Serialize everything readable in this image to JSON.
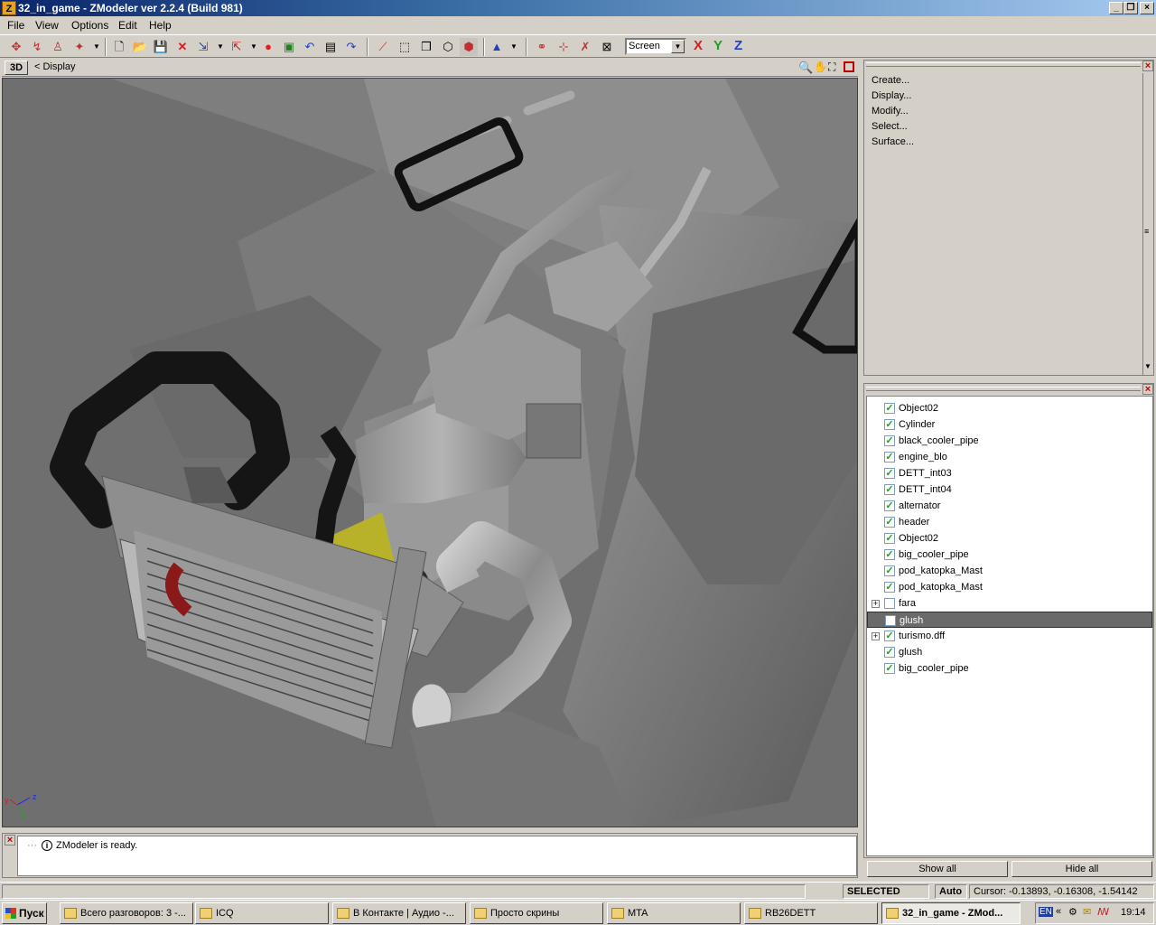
{
  "window": {
    "app_icon": "Z",
    "title": "32_in_game - ZModeler ver 2.2.4 (Build 981)"
  },
  "menu": [
    "File",
    "View",
    "Options",
    "Edit",
    "Help"
  ],
  "toolbar": {
    "view_mode": "Screen",
    "axes": [
      "X",
      "Y",
      "Z"
    ]
  },
  "viewport": {
    "mode_button": "3D",
    "breadcrumb": "< Display",
    "axis_labels": [
      "y",
      "z",
      "x"
    ]
  },
  "command_panel": {
    "commands": [
      "Create...",
      "Display...",
      "Modify...",
      "Select...",
      "Surface..."
    ]
  },
  "object_panel": {
    "objects": [
      {
        "name": "Object02",
        "checked": true,
        "expandable": false,
        "selected": false
      },
      {
        "name": "Cylinder",
        "checked": true,
        "expandable": false,
        "selected": false
      },
      {
        "name": "black_cooler_pipe",
        "checked": true,
        "expandable": false,
        "selected": false
      },
      {
        "name": "engine_blo",
        "checked": true,
        "expandable": false,
        "selected": false
      },
      {
        "name": "DETT_int03",
        "checked": true,
        "expandable": false,
        "selected": false
      },
      {
        "name": "DETT_int04",
        "checked": true,
        "expandable": false,
        "selected": false
      },
      {
        "name": "alternator",
        "checked": true,
        "expandable": false,
        "selected": false
      },
      {
        "name": "header",
        "checked": true,
        "expandable": false,
        "selected": false
      },
      {
        "name": "Object02",
        "checked": true,
        "expandable": false,
        "selected": false
      },
      {
        "name": "big_cooler_pipe",
        "checked": true,
        "expandable": false,
        "selected": false
      },
      {
        "name": "pod_katopka_Mast",
        "checked": true,
        "expandable": false,
        "selected": false
      },
      {
        "name": "pod_katopka_Mast",
        "checked": true,
        "expandable": false,
        "selected": false
      },
      {
        "name": "fara",
        "checked": false,
        "expandable": true,
        "selected": false
      },
      {
        "name": "glush",
        "checked": false,
        "expandable": false,
        "selected": true
      },
      {
        "name": "turismo.dff",
        "checked": true,
        "expandable": true,
        "selected": false
      },
      {
        "name": "glush",
        "checked": true,
        "expandable": false,
        "selected": false
      },
      {
        "name": "big_cooler_pipe",
        "checked": true,
        "expandable": false,
        "selected": false
      }
    ],
    "show_all": "Show all",
    "hide_all": "Hide all"
  },
  "log": {
    "message": "ZModeler is ready."
  },
  "status": {
    "mode": "SELECTED MODE",
    "auto": "Auto",
    "cursor": "Cursor: -0.13893, -0.16308, -1.54142"
  },
  "taskbar": {
    "start": "Пуск",
    "tasks": [
      {
        "label": "Всего разговоров: 3 -...",
        "active": false
      },
      {
        "label": "ICQ",
        "active": false
      },
      {
        "label": "В Контакте | Аудио -...",
        "active": false
      },
      {
        "label": "Просто скрины",
        "active": false
      },
      {
        "label": "MTA",
        "active": false
      },
      {
        "label": "RB26DETT",
        "active": false
      },
      {
        "label": "32_in_game - ZMod...",
        "active": true
      }
    ],
    "lang": "EN",
    "clock": "19:14"
  },
  "colors": {
    "title_start": "#0a246a",
    "title_end": "#a6caf0",
    "viewport_bg": "#6f6f6f",
    "selection": "#6a6a6a"
  }
}
